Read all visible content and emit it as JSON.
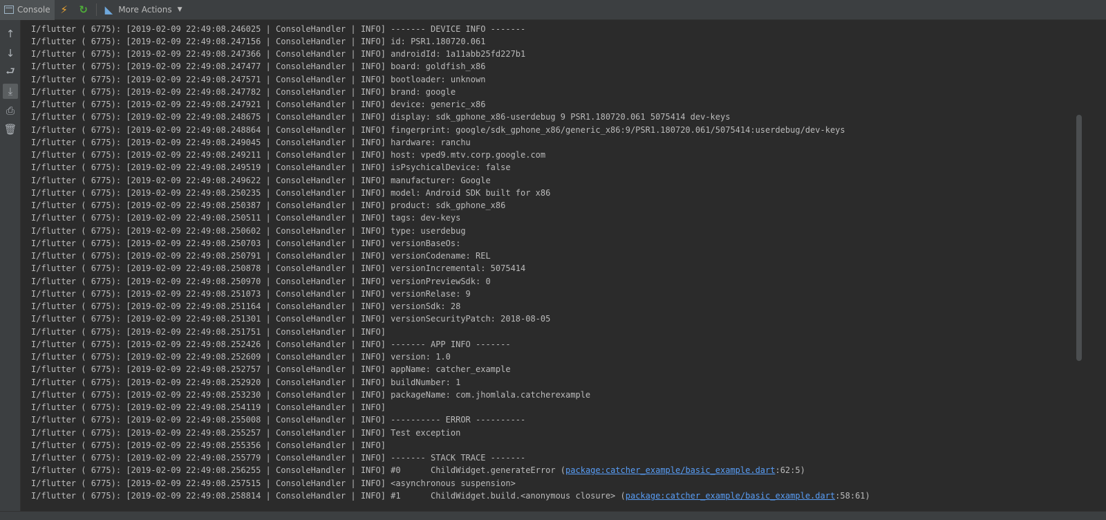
{
  "toolbar": {
    "console_tab_label": "Console",
    "more_actions_label": "More Actions",
    "hot_reload_icon": "lightning-icon",
    "hot_restart_icon": "reload-icon",
    "flutter_inspector_icon": "flutter-icon"
  },
  "left_bar": {
    "icons": [
      "up-arrow-icon",
      "down-arrow-icon",
      "soft-wrap-icon",
      "scroll-to-end-icon",
      "print-icon",
      "trash-icon"
    ]
  },
  "console": {
    "lines": [
      "I/flutter ( 6775): [2019-02-09 22:49:08.246025 | ConsoleHandler | INFO] ------- DEVICE INFO -------",
      "I/flutter ( 6775): [2019-02-09 22:49:08.247156 | ConsoleHandler | INFO] id: PSR1.180720.061",
      "I/flutter ( 6775): [2019-02-09 22:49:08.247366 | ConsoleHandler | INFO] androidId: 1a11abb25fd227b1",
      "I/flutter ( 6775): [2019-02-09 22:49:08.247477 | ConsoleHandler | INFO] board: goldfish_x86",
      "I/flutter ( 6775): [2019-02-09 22:49:08.247571 | ConsoleHandler | INFO] bootloader: unknown",
      "I/flutter ( 6775): [2019-02-09 22:49:08.247782 | ConsoleHandler | INFO] brand: google",
      "I/flutter ( 6775): [2019-02-09 22:49:08.247921 | ConsoleHandler | INFO] device: generic_x86",
      "I/flutter ( 6775): [2019-02-09 22:49:08.248675 | ConsoleHandler | INFO] display: sdk_gphone_x86-userdebug 9 PSR1.180720.061 5075414 dev-keys",
      "I/flutter ( 6775): [2019-02-09 22:49:08.248864 | ConsoleHandler | INFO] fingerprint: google/sdk_gphone_x86/generic_x86:9/PSR1.180720.061/5075414:userdebug/dev-keys",
      "I/flutter ( 6775): [2019-02-09 22:49:08.249045 | ConsoleHandler | INFO] hardware: ranchu",
      "I/flutter ( 6775): [2019-02-09 22:49:08.249211 | ConsoleHandler | INFO] host: vped9.mtv.corp.google.com",
      "I/flutter ( 6775): [2019-02-09 22:49:08.249519 | ConsoleHandler | INFO] isPsychicalDevice: false",
      "I/flutter ( 6775): [2019-02-09 22:49:08.249622 | ConsoleHandler | INFO] manufacturer: Google",
      "I/flutter ( 6775): [2019-02-09 22:49:08.250235 | ConsoleHandler | INFO] model: Android SDK built for x86",
      "I/flutter ( 6775): [2019-02-09 22:49:08.250387 | ConsoleHandler | INFO] product: sdk_gphone_x86",
      "I/flutter ( 6775): [2019-02-09 22:49:08.250511 | ConsoleHandler | INFO] tags: dev-keys",
      "I/flutter ( 6775): [2019-02-09 22:49:08.250602 | ConsoleHandler | INFO] type: userdebug",
      "I/flutter ( 6775): [2019-02-09 22:49:08.250703 | ConsoleHandler | INFO] versionBaseOs:",
      "I/flutter ( 6775): [2019-02-09 22:49:08.250791 | ConsoleHandler | INFO] versionCodename: REL",
      "I/flutter ( 6775): [2019-02-09 22:49:08.250878 | ConsoleHandler | INFO] versionIncremental: 5075414",
      "I/flutter ( 6775): [2019-02-09 22:49:08.250970 | ConsoleHandler | INFO] versionPreviewSdk: 0",
      "I/flutter ( 6775): [2019-02-09 22:49:08.251073 | ConsoleHandler | INFO] versionRelase: 9",
      "I/flutter ( 6775): [2019-02-09 22:49:08.251164 | ConsoleHandler | INFO] versionSdk: 28",
      "I/flutter ( 6775): [2019-02-09 22:49:08.251301 | ConsoleHandler | INFO] versionSecurityPatch: 2018-08-05",
      "I/flutter ( 6775): [2019-02-09 22:49:08.251751 | ConsoleHandler | INFO]",
      "I/flutter ( 6775): [2019-02-09 22:49:08.252426 | ConsoleHandler | INFO] ------- APP INFO -------",
      "I/flutter ( 6775): [2019-02-09 22:49:08.252609 | ConsoleHandler | INFO] version: 1.0",
      "I/flutter ( 6775): [2019-02-09 22:49:08.252757 | ConsoleHandler | INFO] appName: catcher_example",
      "I/flutter ( 6775): [2019-02-09 22:49:08.252920 | ConsoleHandler | INFO] buildNumber: 1",
      "I/flutter ( 6775): [2019-02-09 22:49:08.253230 | ConsoleHandler | INFO] packageName: com.jhomlala.catcherexample",
      "I/flutter ( 6775): [2019-02-09 22:49:08.254119 | ConsoleHandler | INFO]",
      "I/flutter ( 6775): [2019-02-09 22:49:08.255008 | ConsoleHandler | INFO] ---------- ERROR ----------",
      "I/flutter ( 6775): [2019-02-09 22:49:08.255257 | ConsoleHandler | INFO] Test exception",
      "I/flutter ( 6775): [2019-02-09 22:49:08.255356 | ConsoleHandler | INFO]",
      "I/flutter ( 6775): [2019-02-09 22:49:08.255779 | ConsoleHandler | INFO] ------- STACK TRACE -------"
    ],
    "link_lines": [
      {
        "prefix": "I/flutter ( 6775): [2019-02-09 22:49:08.256255 | ConsoleHandler | INFO] #0      ChildWidget.generateError (",
        "link": "package:catcher_example/basic_example.dart",
        "suffix": ":62:5)"
      },
      {
        "prefix": "I/flutter ( 6775): [2019-02-09 22:49:08.257515 | ConsoleHandler | INFO] <asynchronous suspension>",
        "link": "",
        "suffix": ""
      },
      {
        "prefix": "I/flutter ( 6775): [2019-02-09 22:49:08.258814 | ConsoleHandler | INFO] #1      ChildWidget.build.<anonymous closure> (",
        "link": "package:catcher_example/basic_example.dart",
        "suffix": ":58:61)"
      }
    ]
  }
}
